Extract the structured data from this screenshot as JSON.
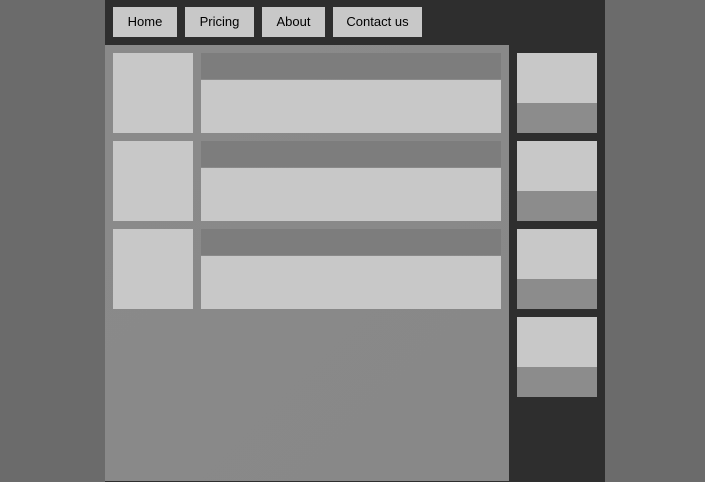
{
  "nav": {
    "items": [
      {
        "label": "Home"
      },
      {
        "label": "Pricing"
      },
      {
        "label": "About"
      },
      {
        "label": "Contact us"
      }
    ]
  }
}
